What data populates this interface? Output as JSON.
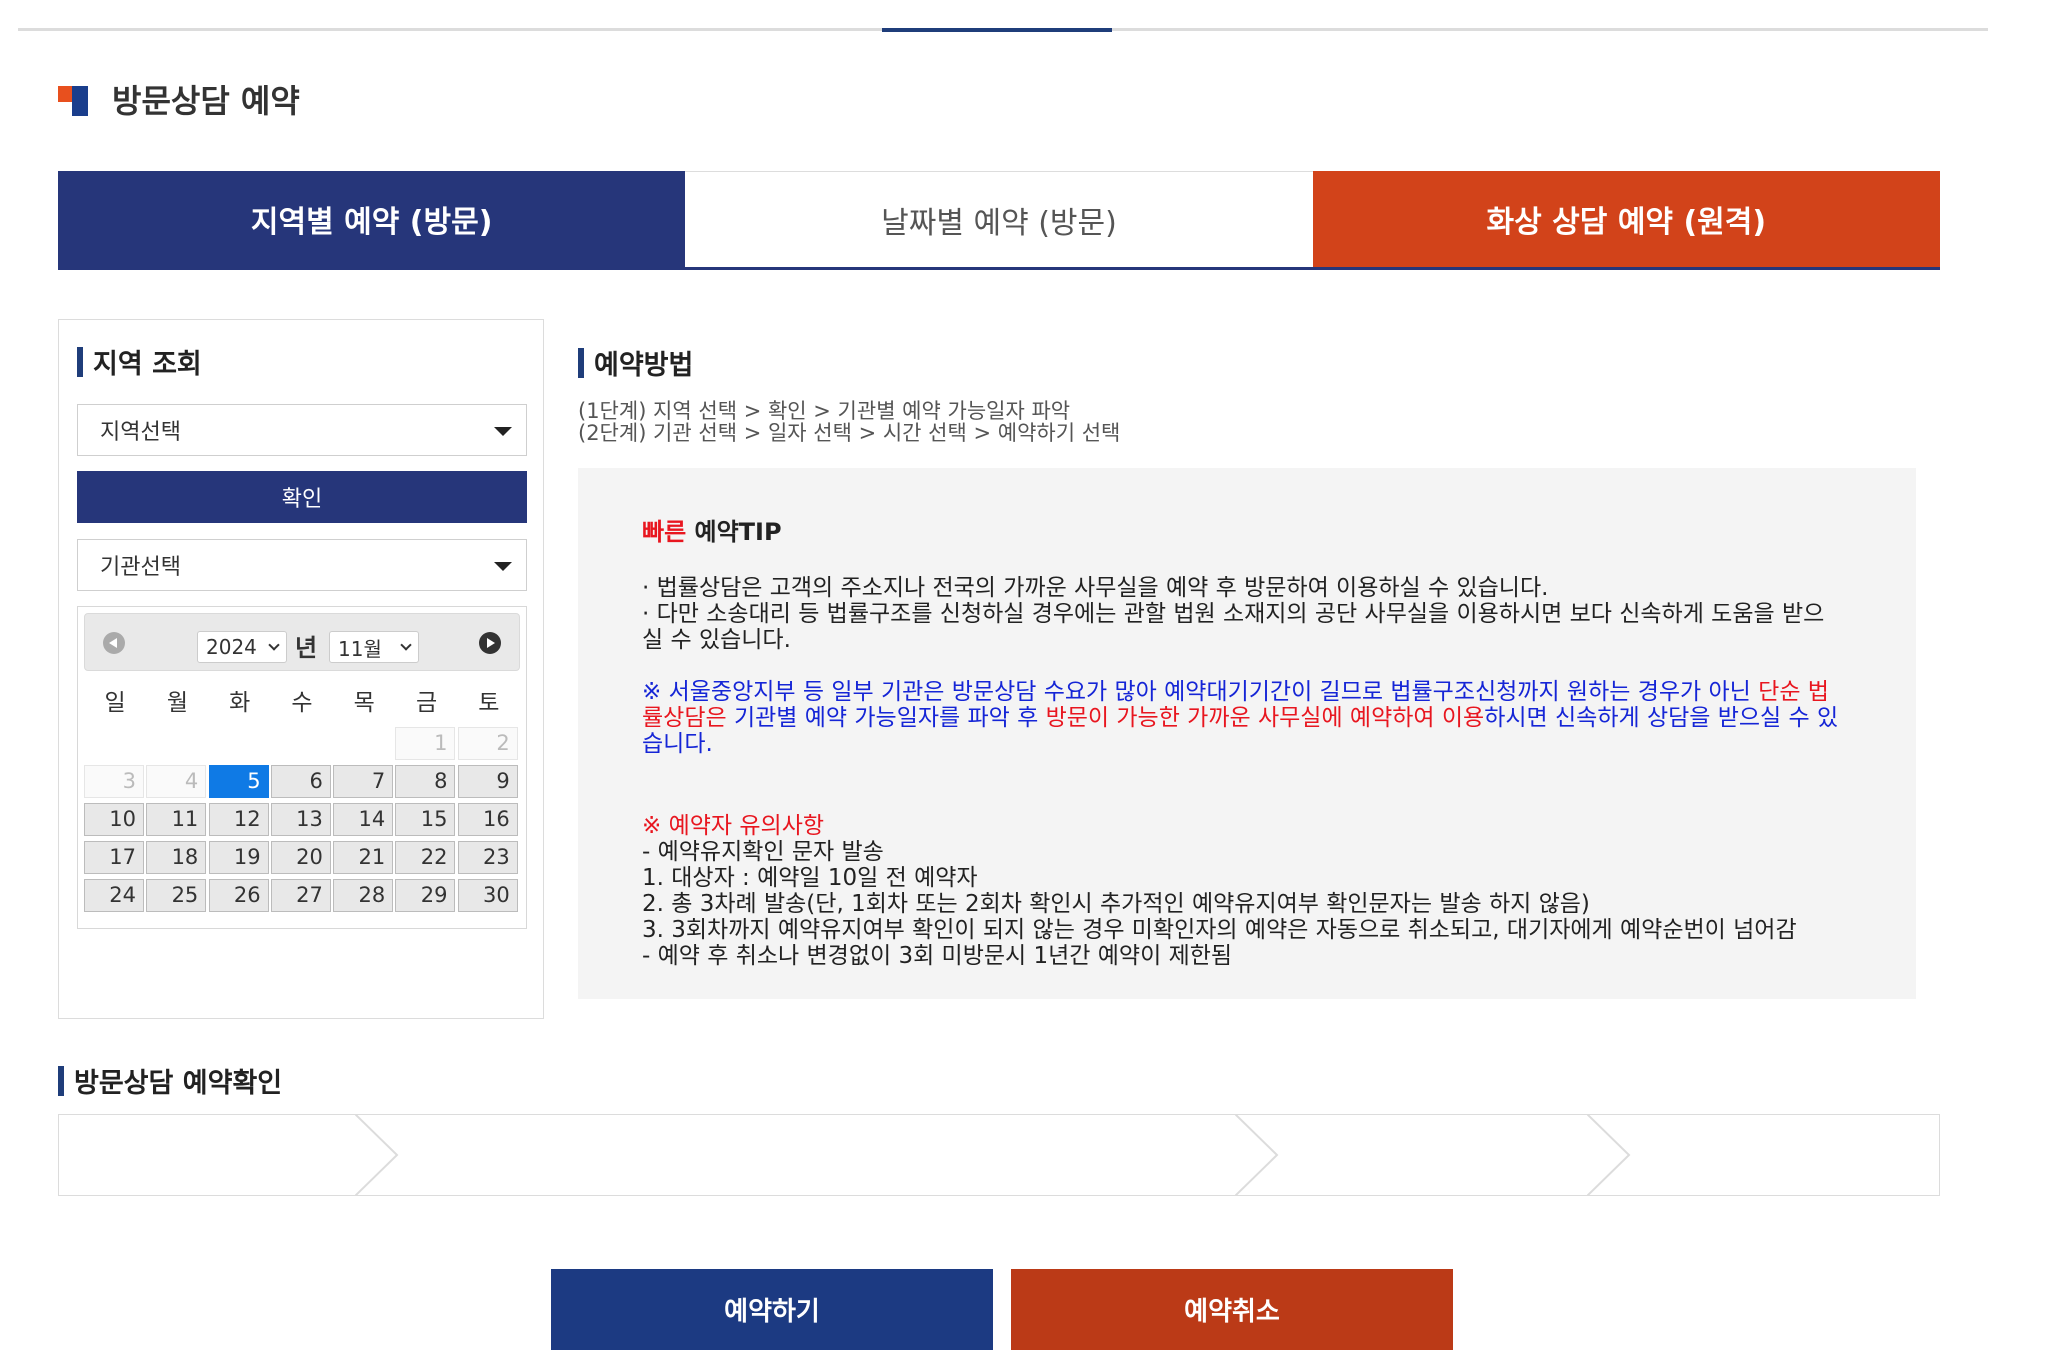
{
  "page_title": "방문상담 예약",
  "tabs": [
    {
      "label": "지역별 예약 (방문)"
    },
    {
      "label": "날짜별 예약 (방문)"
    },
    {
      "label": "화상 상담 예약 (원격)"
    }
  ],
  "left_panel": {
    "heading": "지역 조회",
    "region_select": "지역선택",
    "confirm_label": "확인",
    "agency_select": "기관선택"
  },
  "calendar": {
    "year": "2024",
    "year_suffix": "년",
    "month": "11월",
    "weekdays": [
      "일",
      "월",
      "화",
      "수",
      "목",
      "금",
      "토"
    ],
    "days": [
      {
        "n": "",
        "type": "empty"
      },
      {
        "n": "",
        "type": "empty"
      },
      {
        "n": "",
        "type": "empty"
      },
      {
        "n": "",
        "type": "empty"
      },
      {
        "n": "",
        "type": "empty"
      },
      {
        "n": "1",
        "type": "dim"
      },
      {
        "n": "2",
        "type": "dim"
      },
      {
        "n": "3",
        "type": "dim"
      },
      {
        "n": "4",
        "type": "dim"
      },
      {
        "n": "5",
        "type": "sel"
      },
      {
        "n": "6",
        "type": "avail"
      },
      {
        "n": "7",
        "type": "avail"
      },
      {
        "n": "8",
        "type": "avail"
      },
      {
        "n": "9",
        "type": "avail"
      },
      {
        "n": "10",
        "type": "avail"
      },
      {
        "n": "11",
        "type": "avail"
      },
      {
        "n": "12",
        "type": "avail"
      },
      {
        "n": "13",
        "type": "avail"
      },
      {
        "n": "14",
        "type": "avail"
      },
      {
        "n": "15",
        "type": "avail"
      },
      {
        "n": "16",
        "type": "avail"
      },
      {
        "n": "17",
        "type": "avail"
      },
      {
        "n": "18",
        "type": "avail"
      },
      {
        "n": "19",
        "type": "avail"
      },
      {
        "n": "20",
        "type": "avail"
      },
      {
        "n": "21",
        "type": "avail"
      },
      {
        "n": "22",
        "type": "avail"
      },
      {
        "n": "23",
        "type": "avail"
      },
      {
        "n": "24",
        "type": "avail"
      },
      {
        "n": "25",
        "type": "avail"
      },
      {
        "n": "26",
        "type": "avail"
      },
      {
        "n": "27",
        "type": "avail"
      },
      {
        "n": "28",
        "type": "avail"
      },
      {
        "n": "29",
        "type": "avail"
      },
      {
        "n": "30",
        "type": "avail"
      }
    ]
  },
  "method": {
    "heading": "예약방법",
    "step1": "(1단계) 지역 선택 > 확인 > 기관별 예약 가능일자 파악",
    "step2": "(2단계) 기관 선택 > 일자 선택 > 시간 선택 > 예약하기 선택"
  },
  "tip": {
    "title_red": "빠른",
    "title_rest": " 예약TIP",
    "line1": "· 법률상담은 고객의 주소지나 전국의 가까운 사무실을 예약 후 방문하여 이용하실 수 있습니다.",
    "line2": "· 다만 소송대리 등 법률구조를 신청하실 경우에는 관할 법원 소재지의 공단 사무실을 이용하시면 보다 신속하게 도움을 받으실 수 있습니다.",
    "notice_part1": "※ 서울중앙지부 등 일부 기관은 방문상담 수요가 많아 예약대기기간이 길므로 법률구조신청까지 원하는 경우가 아닌 ",
    "notice_red1": "단순 법률상담은",
    "notice_part2": " 기관별 예약 가능일자를 파악 후 ",
    "notice_red2": "방문이 가능한 가까운 사무실에 예약하여 이용",
    "notice_part3": "하시면 신속하게 상담을 받으실 수 있습니다.",
    "notes_heading": "※ 예약자 유의사항",
    "notes": [
      "- 예약유지확인 문자 발송",
      "1. 대상자 : 예약일 10일 전 예약자",
      "2. 총 3차례 발송(단, 1회차 또는 2회차 확인시 추가적인 예약유지여부 확인문자는 발송 하지 않음)",
      "3. 3회차까지 예약유지여부 확인이 되지 않는 경우 미확인자의 예약은 자동으로 취소되고, 대기자에게 예약순번이 넘어감",
      "- 예약 후 취소나 변경없이 3회 미방문시 1년간 예약이 제한됨"
    ]
  },
  "confirm_section": {
    "heading": "방문상담 예약확인"
  },
  "actions": {
    "reserve": "예약하기",
    "cancel": "예약취소"
  },
  "colors": {
    "navy": "#26367a",
    "orange": "#d2431a",
    "selected_day": "#0f7ae5",
    "tip_red": "#e8161f",
    "tip_blue": "#1525d6"
  }
}
